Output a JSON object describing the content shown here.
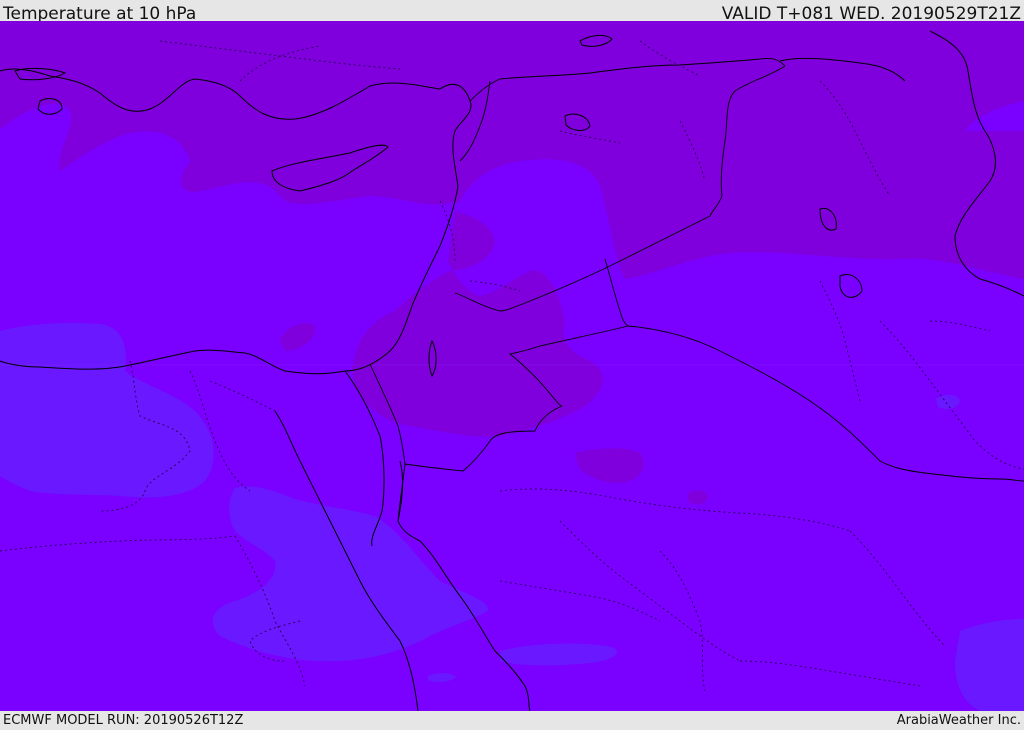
{
  "header": {
    "title": "Temperature at 10 hPa",
    "valid": "VALID T+081 WED. 20190529T21Z"
  },
  "footer": {
    "model_run": "ECMWF MODEL RUN: 20190526T12Z",
    "credit": "ArabiaWeather Inc."
  },
  "colors": {
    "bar_bg": "#e6e6e6",
    "field_base": "#7a00ff",
    "field_warm": "#7f00dd",
    "field_cool": "#6a18ff",
    "coastline": "#000000",
    "borders": "#2a0050"
  }
}
